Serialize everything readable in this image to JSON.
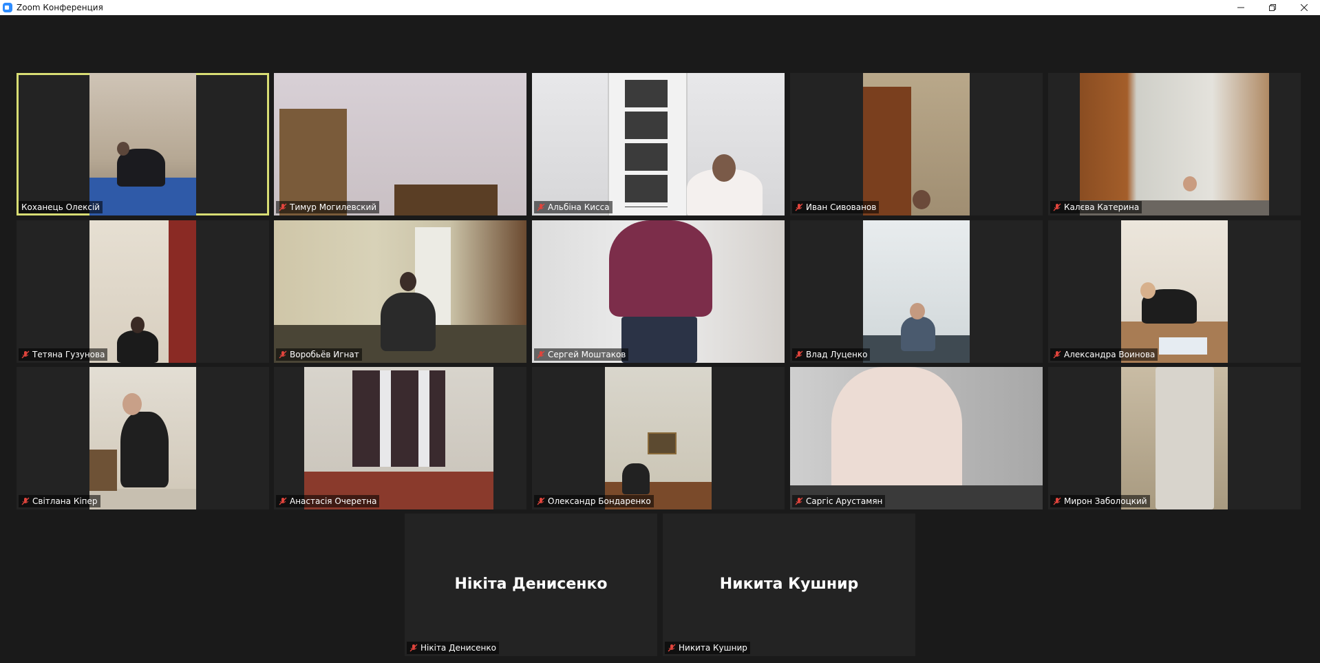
{
  "window": {
    "title": "Zoom Конференция",
    "minimize_glyph": "—",
    "restore_glyph": "❐",
    "close_glyph": "✕"
  },
  "colors": {
    "active_speaker_border": "#d8dd74",
    "muted_icon": "#e0443c",
    "background": "#1a1a1a",
    "tile_background": "#232323"
  },
  "participants": [
    {
      "name": "Коханець Олексій",
      "muted": false,
      "active": true
    },
    {
      "name": "Тимур Могилевский",
      "muted": true
    },
    {
      "name": "Альбіна Кисса",
      "muted": true
    },
    {
      "name": "Иван Сивованов",
      "muted": true
    },
    {
      "name": "Калєва Катерина",
      "muted": true
    },
    {
      "name": "Тетяна Гузунова",
      "muted": true
    },
    {
      "name": "Воробьёв Игнат",
      "muted": true
    },
    {
      "name": "Сергей Моштаков",
      "muted": true
    },
    {
      "name": "Влад Луценко",
      "muted": true
    },
    {
      "name": "Александра Воинова",
      "muted": true
    },
    {
      "name": "Світлана Кіпер",
      "muted": true
    },
    {
      "name": "Анастасія Очеретна",
      "muted": true
    },
    {
      "name": "Олександр Бондаренко",
      "muted": true
    },
    {
      "name": "Саргіс Арустамян",
      "muted": true
    },
    {
      "name": "Мирон Заболоцкий",
      "muted": true
    },
    {
      "name": "Нікіта Денисенко",
      "muted": true,
      "video_off": true
    },
    {
      "name": "Никита Кушнир",
      "muted": true,
      "video_off": true
    }
  ]
}
